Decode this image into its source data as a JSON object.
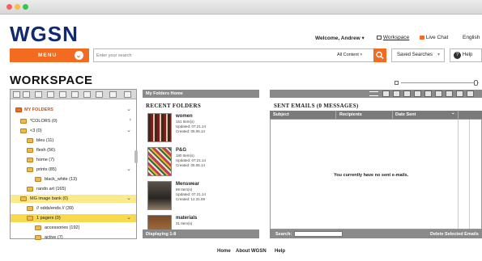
{
  "brand": {
    "logo_text": "WGSN",
    "accent": "#f26b21",
    "logo_color": "#0f2a73"
  },
  "topnav": {
    "welcome": "Welcome, Andrew",
    "workspace": "Workspace",
    "live_chat": "Live Chat",
    "language": "English"
  },
  "search": {
    "menu_label": "MENU",
    "placeholder": "Enter your search",
    "scope": "All Content",
    "saved_searches": "Saved Searches",
    "help": "Help"
  },
  "page": {
    "title": "WORKSPACE"
  },
  "folders": {
    "root_label": "MY FOLDERS",
    "items": [
      {
        "label": "*COLORS (0)"
      },
      {
        "label": "<3 (0)"
      },
      {
        "label": "bleu (11)"
      },
      {
        "label": "flesh (56)"
      },
      {
        "label": "home (7)"
      },
      {
        "label": "prints (85)"
      },
      {
        "label": "black_white (13)"
      },
      {
        "label": "rando art (165)"
      },
      {
        "label": "MG image bank (0)"
      },
      {
        "label": "// odds/ends // (39)"
      },
      {
        "label": "1 pagers (0)"
      },
      {
        "label": "accessories (192)"
      },
      {
        "label": "active (7)"
      }
    ]
  },
  "recent": {
    "header": "My Folders Home",
    "title": "RECENT FOLDERS",
    "footer": "Displaying 1-8",
    "items": [
      {
        "name": "women",
        "count": "151 Item(s)",
        "updated": "Updated: 07.21.14",
        "created": "Created: 05.06.14"
      },
      {
        "name": "P&G",
        "count": "180 Item(s)",
        "updated": "Updated: 07.21.14",
        "created": "Created: 05.06.14"
      },
      {
        "name": "Menswear",
        "count": "89 Item(s)",
        "updated": "Updated: 07.21.14",
        "created": "Created: 12.31.69"
      },
      {
        "name": "materials",
        "count": "31 Item(s)",
        "updated": "",
        "created": ""
      }
    ]
  },
  "sent": {
    "title": "SENT EMAILS (0 MESSAGES)",
    "columns": [
      "Subject",
      "Recipients",
      "Date Sent"
    ],
    "empty_text": "You currently have no sent e-mails.",
    "search_label": "Search:",
    "delete_label": "Delete Selected Emails"
  },
  "footer": {
    "links": [
      "Home",
      "About WGSN",
      "Help"
    ]
  }
}
